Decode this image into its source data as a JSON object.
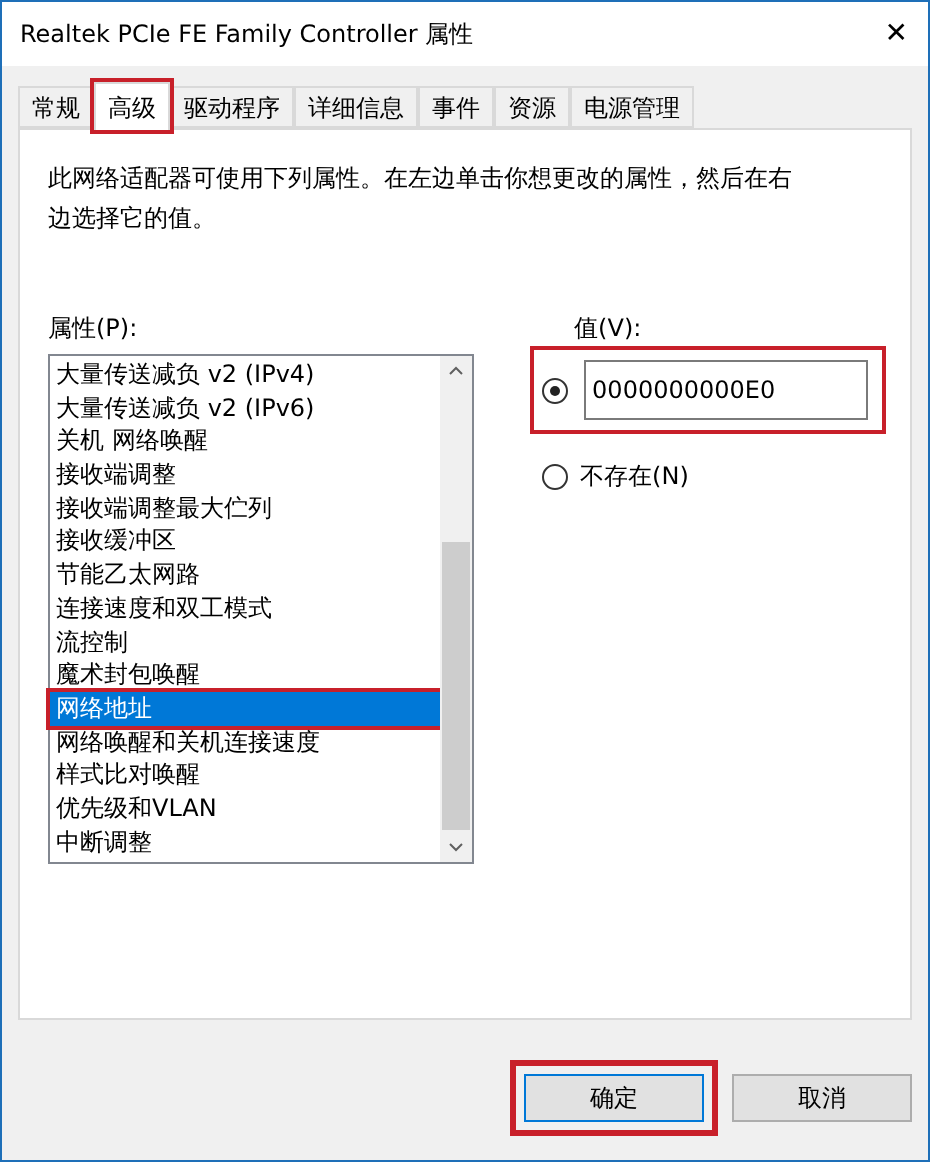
{
  "window": {
    "title": "Realtek PCIe FE Family Controller 属性",
    "close": "✕"
  },
  "tabs": [
    {
      "label": "常规",
      "selected": false,
      "highlighted": false
    },
    {
      "label": "高级",
      "selected": true,
      "highlighted": true
    },
    {
      "label": "驱动程序",
      "selected": false,
      "highlighted": false
    },
    {
      "label": "详细信息",
      "selected": false,
      "highlighted": false
    },
    {
      "label": "事件",
      "selected": false,
      "highlighted": false
    },
    {
      "label": "资源",
      "selected": false,
      "highlighted": false
    },
    {
      "label": "电源管理",
      "selected": false,
      "highlighted": false
    }
  ],
  "description": "此网络适配器可使用下列属性。在左边单击你想更改的属性，然后在右边选择它的值。",
  "properties": {
    "label": "属性(P):",
    "items": [
      {
        "label": "大量传送减负 v2 (IPv4)",
        "selected": false,
        "highlighted": false
      },
      {
        "label": "大量传送减负 v2 (IPv6)",
        "selected": false,
        "highlighted": false
      },
      {
        "label": "关机 网络唤醒",
        "selected": false,
        "highlighted": false
      },
      {
        "label": "接收端调整",
        "selected": false,
        "highlighted": false
      },
      {
        "label": "接收端调整最大伫列",
        "selected": false,
        "highlighted": false
      },
      {
        "label": "接收缓冲区",
        "selected": false,
        "highlighted": false
      },
      {
        "label": "节能乙太网路",
        "selected": false,
        "highlighted": false
      },
      {
        "label": "连接速度和双工模式",
        "selected": false,
        "highlighted": false
      },
      {
        "label": "流控制",
        "selected": false,
        "highlighted": false
      },
      {
        "label": "魔术封包唤醒",
        "selected": false,
        "highlighted": false
      },
      {
        "label": "网络地址",
        "selected": true,
        "highlighted": true
      },
      {
        "label": "网络唤醒和关机连接速度",
        "selected": false,
        "highlighted": false
      },
      {
        "label": "样式比对唤醒",
        "selected": false,
        "highlighted": false
      },
      {
        "label": "优先级和VLAN",
        "selected": false,
        "highlighted": false
      },
      {
        "label": "中断调整",
        "selected": false,
        "highlighted": false
      }
    ]
  },
  "value": {
    "label": "值(V):",
    "highlighted": true,
    "options": [
      {
        "kind": "field",
        "selected": true,
        "value": "0000000000E0"
      },
      {
        "kind": "text",
        "selected": false,
        "label": "不存在(N)"
      }
    ]
  },
  "buttons": [
    {
      "label": "确定",
      "highlighted": true
    },
    {
      "label": "取消",
      "highlighted": false
    }
  ]
}
